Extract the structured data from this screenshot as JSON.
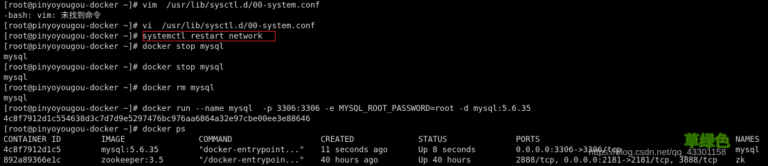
{
  "terminal": {
    "lines": [
      "[root@pinyoyougou-docker ~]# vim  /usr/lib/sysctl.d/00-system.conf",
      "-bash: vim: 未找到命令",
      "[root@pinyoyougou-docker ~]# vi  /usr/lib/sysctl.d/00-system.conf",
      "[root@pinyoyougou-docker ~]# systemctl restart network",
      "[root@pinyoyougou-docker ~]# docker stop mysql",
      "mysql",
      "[root@pinyoyougou-docker ~]# docker stop mysql",
      "mysql",
      "[root@pinyoyougou-docker ~]# docker rm mysql",
      "mysql",
      "[root@pinyoyougou-docker ~]# docker run --name mysql  -p 3306:3306 -e MYSQL_ROOT_PASSWORD=root -d mysql:5.6.35",
      "4c8f7912d1c554638d3c7d7d9e5297476bc976aa6864a32e97cbe00ee3e88646",
      "[root@pinyoyougou-docker ~]# docker ps"
    ],
    "table": {
      "headers": [
        "CONTAINER ID",
        "IMAGE",
        "COMMAND",
        "CREATED",
        "STATUS",
        "PORTS",
        "NAMES"
      ],
      "rows": [
        [
          "4c8f7912d1c5",
          "mysql:5.6.35",
          "\"docker-entrypoint...\"",
          "11 seconds ago",
          "Up 8 seconds",
          "0.0.0.0:3306->3306/tcp",
          "mysql"
        ],
        [
          "892a89366e1c",
          "zookeeper:3.5",
          "\"/docker-entrypoin...\"",
          "40 hours ago",
          "Up 40 hours",
          "2888/tcp, 0.0.0.0:2181->2181/tcp, 3888/tcp",
          "zk"
        ]
      ]
    },
    "highlight_color": "#e02020"
  },
  "watermark": {
    "url": "https://blog.csdn.net/qq_43301158",
    "badge": "草绿色"
  }
}
